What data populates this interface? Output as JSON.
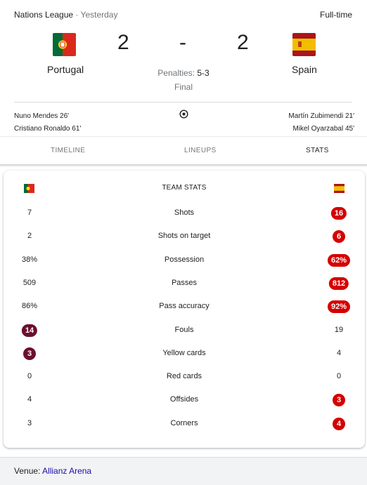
{
  "match": {
    "league": "Nations League",
    "separator": "·",
    "when": "Yesterday",
    "status": "Full-time",
    "home": {
      "name": "Portugal",
      "score": "2",
      "flag_icon": "portugal-flag-icon"
    },
    "away": {
      "name": "Spain",
      "score": "2",
      "flag_icon": "spain-flag-icon"
    },
    "score_separator": "-",
    "penalties_label": "Penalties:",
    "penalties_score": "5-3",
    "result": "Final",
    "home_scorers": [
      "Nuno Mendes 26'",
      "Cristiano Ronaldo 61'"
    ],
    "away_scorers": [
      "Martín Zubimendi 21'",
      "Mikel Oyarzabal 45'"
    ],
    "goal_icon": "soccer-ball-icon"
  },
  "tabs": [
    {
      "label": "TIMELINE",
      "active": false
    },
    {
      "label": "LINEUPS",
      "active": false
    },
    {
      "label": "STATS",
      "active": true
    }
  ],
  "team_stats": {
    "title": "TEAM STATS",
    "rows": [
      {
        "label": "Shots",
        "home": "7",
        "away": "16",
        "highlight": "away"
      },
      {
        "label": "Shots on target",
        "home": "2",
        "away": "6",
        "highlight": "away"
      },
      {
        "label": "Possession",
        "home": "38%",
        "away": "62%",
        "highlight": "away"
      },
      {
        "label": "Passes",
        "home": "509",
        "away": "812",
        "highlight": "away"
      },
      {
        "label": "Pass accuracy",
        "home": "86%",
        "away": "92%",
        "highlight": "away"
      },
      {
        "label": "Fouls",
        "home": "14",
        "away": "19",
        "highlight": "home"
      },
      {
        "label": "Yellow cards",
        "home": "3",
        "away": "4",
        "highlight": "home"
      },
      {
        "label": "Red cards",
        "home": "0",
        "away": "0",
        "highlight": "none"
      },
      {
        "label": "Offsides",
        "home": "4",
        "away": "3",
        "highlight": "away"
      },
      {
        "label": "Corners",
        "home": "3",
        "away": "4",
        "highlight": "away"
      }
    ]
  },
  "footer": {
    "venue_label": "Venue:",
    "venue_name": "Allianz Arena"
  },
  "colors": {
    "away_highlight": "#d50000",
    "home_highlight": "#6d0f2e",
    "link": "#1a0dab"
  }
}
